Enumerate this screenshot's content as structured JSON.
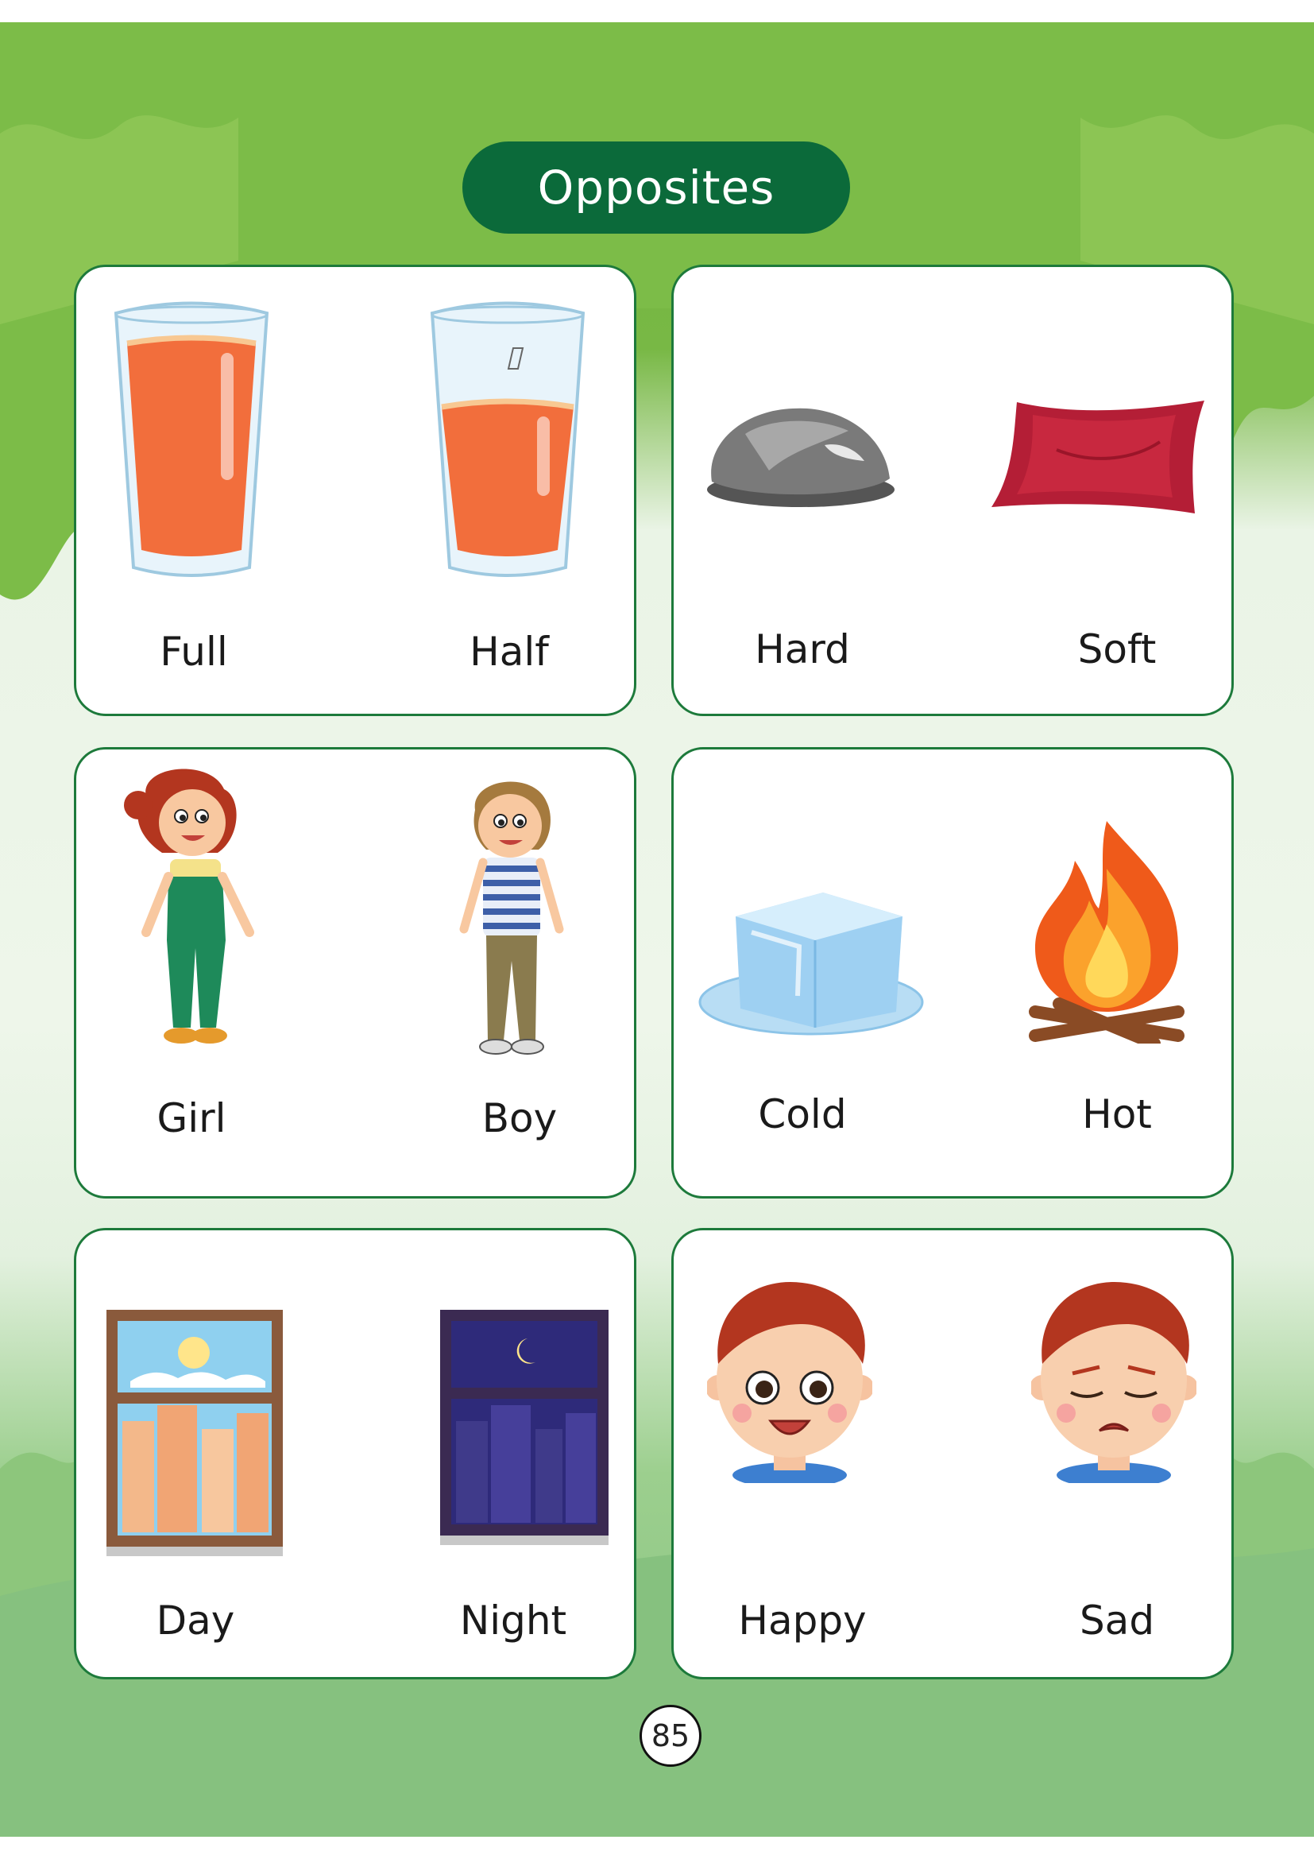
{
  "title": "Opposites",
  "pairs": [
    {
      "left": {
        "word": "Full",
        "icon": "full-glass-icon"
      },
      "right": {
        "word": "Half",
        "icon": "half-glass-icon"
      }
    },
    {
      "left": {
        "word": "Hard",
        "icon": "rock-icon"
      },
      "right": {
        "word": "Soft",
        "icon": "pillow-icon"
      }
    },
    {
      "left": {
        "word": "Girl",
        "icon": "girl-icon"
      },
      "right": {
        "word": "Boy",
        "icon": "boy-icon"
      }
    },
    {
      "left": {
        "word": "Cold",
        "icon": "ice-cube-icon"
      },
      "right": {
        "word": "Hot",
        "icon": "fire-icon"
      }
    },
    {
      "left": {
        "word": "Day",
        "icon": "day-window-icon"
      },
      "right": {
        "word": "Night",
        "icon": "night-window-icon"
      }
    },
    {
      "left": {
        "word": "Happy",
        "icon": "happy-face-icon"
      },
      "right": {
        "word": "Sad",
        "icon": "sad-face-icon"
      }
    }
  ],
  "page_number": "85",
  "colors": {
    "title_pill": "#0b6a3a",
    "card_border": "#1d7a3b",
    "page_top_green": "#6fb23f"
  }
}
